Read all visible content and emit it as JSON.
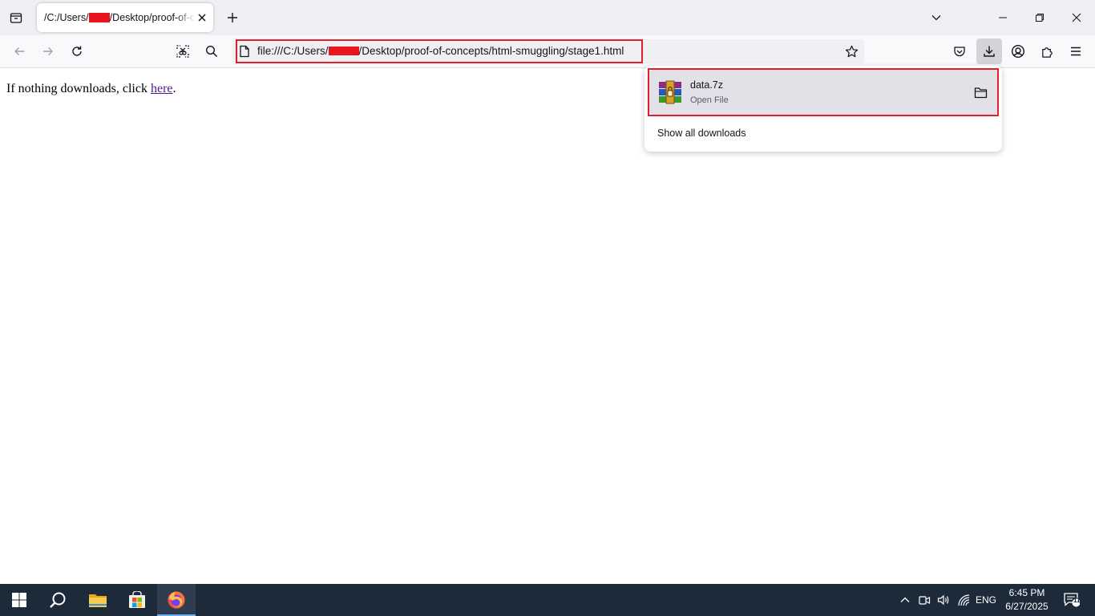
{
  "tab": {
    "title_prefix": "/C:/Users/",
    "title_suffix": "/Desktop/proof-of-c"
  },
  "urlbar": {
    "url_prefix": "file:///C:/Users/",
    "url_suffix": "/Desktop/proof-of-concepts/html-smuggling/stage1.html"
  },
  "page": {
    "text_before": "If nothing downloads, click ",
    "link_text": "here",
    "text_after": "."
  },
  "downloads_panel": {
    "file_name": "data.7z",
    "status": "Open File",
    "show_all_label": "Show all downloads"
  },
  "taskbar": {
    "language": "ENG",
    "time": "6:45 PM",
    "date": "6/27/2025",
    "notification_count": "11"
  },
  "colors": {
    "highlight_box": "#e11e2a",
    "redaction": "#e8141e",
    "taskbar_bg": "#1c2a3a",
    "link": "#551a8b"
  },
  "icons": [
    "tab-list-icon",
    "close-icon",
    "plus-icon",
    "chevron-down-icon",
    "minimize-icon",
    "restore-icon",
    "back-icon",
    "forward-icon",
    "reload-icon",
    "screenshot-icon",
    "search-icon",
    "file-icon",
    "star-icon",
    "pocket-icon",
    "download-icon",
    "account-icon",
    "extensions-icon",
    "menu-icon",
    "archive-icon",
    "folder-icon",
    "windows-start-icon",
    "file-explorer-icon",
    "store-icon",
    "firefox-icon",
    "chevron-up-icon",
    "camera-icon",
    "volume-icon",
    "wifi-icon",
    "notification-icon"
  ]
}
